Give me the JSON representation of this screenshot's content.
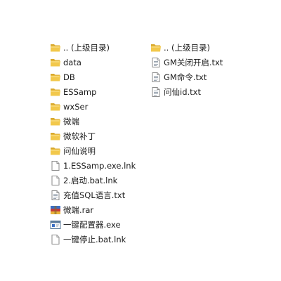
{
  "left_column": {
    "items": [
      {
        "label": ".. (上级目录)",
        "icon": "folder-icon"
      },
      {
        "label": "data",
        "icon": "folder-icon"
      },
      {
        "label": "DB",
        "icon": "folder-icon"
      },
      {
        "label": "ESSamp",
        "icon": "folder-icon"
      },
      {
        "label": "wxSer",
        "icon": "folder-icon"
      },
      {
        "label": "微端",
        "icon": "folder-icon"
      },
      {
        "label": "微软补丁",
        "icon": "folder-icon"
      },
      {
        "label": "问仙说明",
        "icon": "folder-icon"
      },
      {
        "label": "1.ESSamp.exe.lnk",
        "icon": "file-icon"
      },
      {
        "label": "2.启动.bat.lnk",
        "icon": "file-icon"
      },
      {
        "label": "充值SQL语言.txt",
        "icon": "text-file-icon"
      },
      {
        "label": "微端.rar",
        "icon": "archive-icon"
      },
      {
        "label": "一键配置器.exe",
        "icon": "exe-icon"
      },
      {
        "label": "一键停止.bat.lnk",
        "icon": "file-icon"
      }
    ]
  },
  "right_column": {
    "items": [
      {
        "label": ".. (上级目录)",
        "icon": "folder-icon"
      },
      {
        "label": "GM关闭开启.txt",
        "icon": "text-file-icon"
      },
      {
        "label": "GM命令.txt",
        "icon": "text-file-icon"
      },
      {
        "label": "问仙id.txt",
        "icon": "text-file-icon"
      }
    ]
  },
  "colors": {
    "folder_front": "#f2c84b",
    "folder_back": "#d9a92e",
    "file_border": "#8a8a8a",
    "archive_blue": "#3a6fc4",
    "archive_red": "#c43a3a",
    "archive_gold": "#e8b43a",
    "exe_frame": "#5a7a9a"
  }
}
